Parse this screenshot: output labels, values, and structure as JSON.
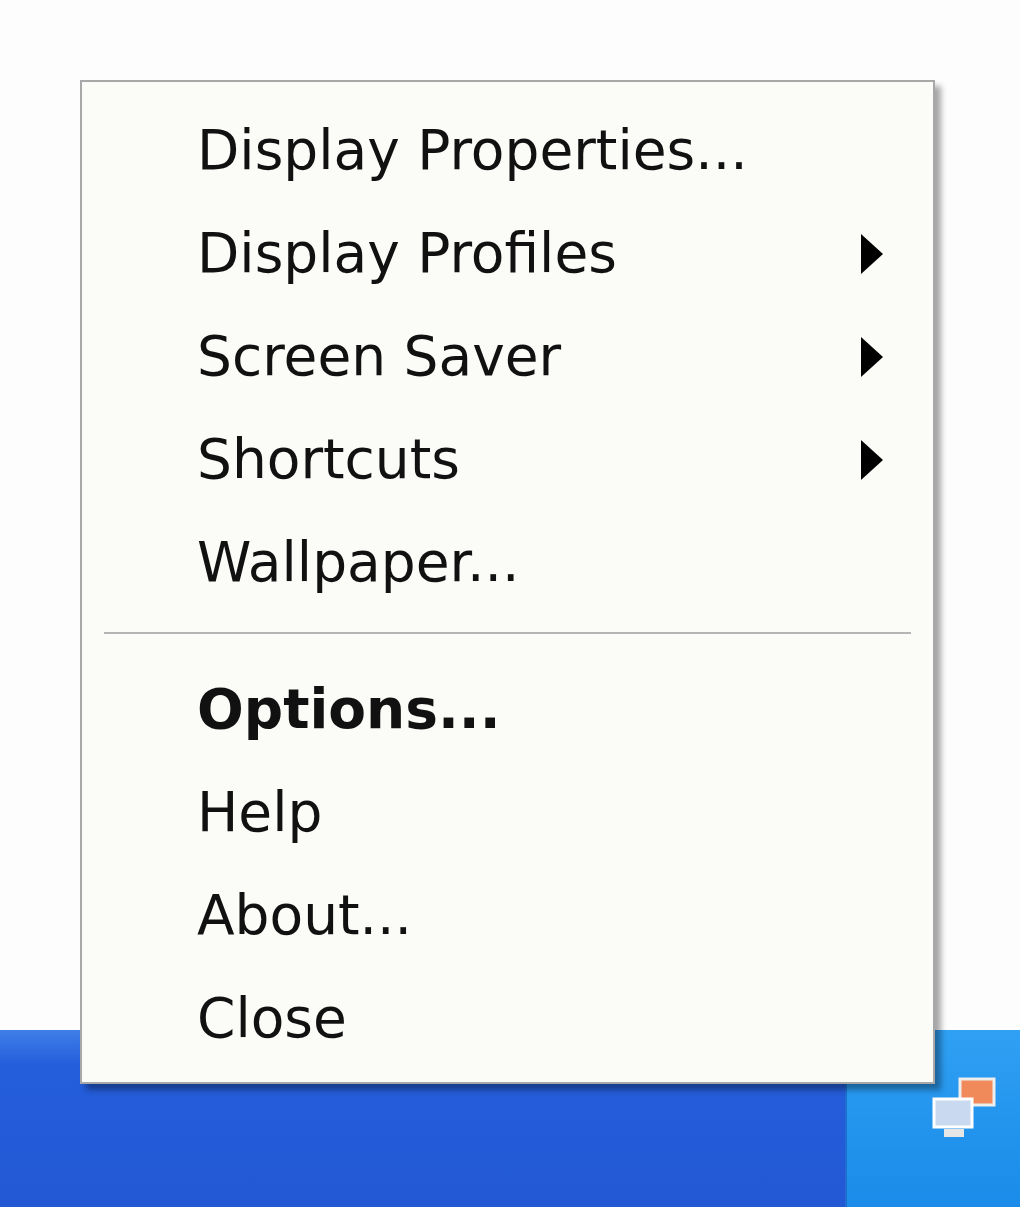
{
  "context_menu": {
    "items": [
      {
        "kind": "item",
        "label": "Display Properties...",
        "submenu": false,
        "default": false
      },
      {
        "kind": "item",
        "label": "Display Profiles",
        "submenu": true,
        "default": false
      },
      {
        "kind": "item",
        "label": "Screen Saver",
        "submenu": true,
        "default": false
      },
      {
        "kind": "item",
        "label": "Shortcuts",
        "submenu": true,
        "default": false
      },
      {
        "kind": "item",
        "label": "Wallpaper...",
        "submenu": false,
        "default": false
      },
      {
        "kind": "separator"
      },
      {
        "kind": "item",
        "label": "Options...",
        "submenu": false,
        "default": true
      },
      {
        "kind": "item",
        "label": "Help",
        "submenu": false,
        "default": false
      },
      {
        "kind": "item",
        "label": "About...",
        "submenu": false,
        "default": false
      },
      {
        "kind": "item",
        "label": "Close",
        "submenu": false,
        "default": false
      }
    ]
  }
}
